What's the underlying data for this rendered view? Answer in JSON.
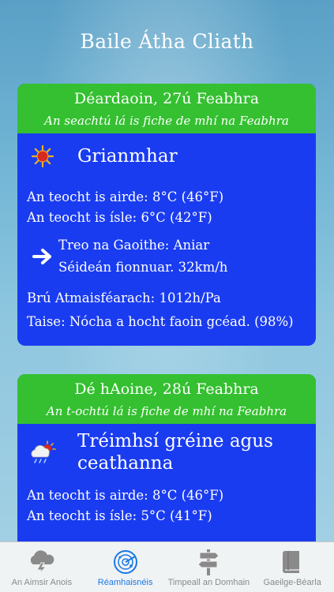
{
  "header": {
    "title": "Baile Átha Cliath"
  },
  "days": [
    {
      "date": "Déardaoin, 27ú Feabhra",
      "date_long": "An seachtú lá is fiche de mhí na Feabhra",
      "icon": "sun-icon",
      "condition": "Grianmhar",
      "temp_high": "An teocht is airde: 8°C (46°F)",
      "temp_low": "An teocht is ísle: 6°C (42°F)",
      "wind_direction": "Treo na Gaoithe: Aniar",
      "wind_speed": "Séideán fionnuar. 32km/h",
      "pressure": "Brú Atmaisféarach: 1012h/Pa",
      "humidity": "Taise: Nócha a hocht faoin gcéad. (98%)"
    },
    {
      "date": "Dé hAoine, 28ú Feabhra",
      "date_long": "An t-ochtú lá is fiche de mhí na Feabhra",
      "icon": "sun-cloud-rain-icon",
      "condition_line1": "Tréimhsí gréine agus",
      "condition_line2": "ceathanna",
      "temp_high": "An teocht is airde: 8°C (46°F)",
      "temp_low": "An teocht is ísle: 5°C (41°F)"
    }
  ],
  "tabbar": {
    "tabs": [
      {
        "label": "An Aimsir Anois",
        "icon": "storm-cloud-icon",
        "active": false
      },
      {
        "label": "Réamhaisnéis",
        "icon": "radar-icon",
        "active": true
      },
      {
        "label": "Timpeall an Domhain",
        "icon": "signpost-icon",
        "active": false
      },
      {
        "label": "Gaeilge-Béarla",
        "icon": "book-icon",
        "active": false
      }
    ]
  },
  "colors": {
    "card_header": "#34c030",
    "card_body": "#1a3cf0",
    "active_tab": "#1a78e6"
  }
}
